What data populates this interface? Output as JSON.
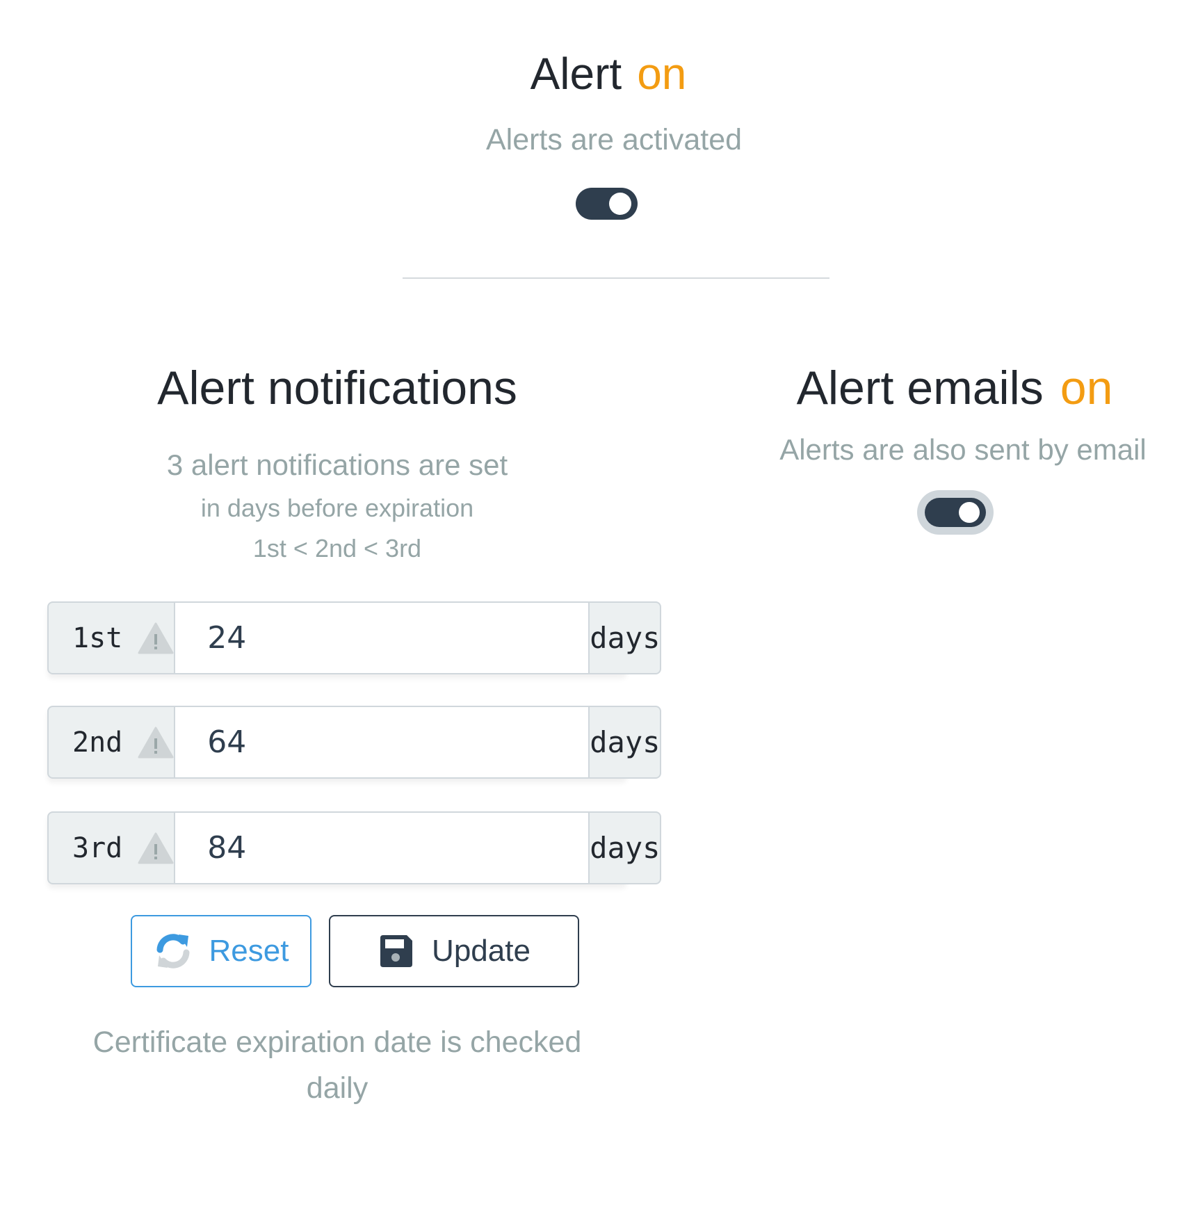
{
  "alert": {
    "title": "Alert",
    "state_label": "on",
    "subtitle": "Alerts are activated",
    "toggle_on": true
  },
  "notifications": {
    "title": "Alert notifications",
    "description_line1": "3 alert notifications are set",
    "description_line2": "in days before expiration",
    "description_line3": "1st < 2nd < 3rd",
    "rows": [
      {
        "ordinal": "1st",
        "value": "24",
        "unit": "days",
        "icon": "warning-icon"
      },
      {
        "ordinal": "2nd",
        "value": "64",
        "unit": "days",
        "icon": "warning-icon"
      },
      {
        "ordinal": "3rd",
        "value": "84",
        "unit": "days",
        "icon": "warning-icon"
      }
    ],
    "reset_label": "Reset",
    "reset_icon": "refresh-icon",
    "update_label": "Update",
    "update_icon": "floppy-disk-icon",
    "footer_note": "Certificate expiration date is checked daily"
  },
  "emails": {
    "title": "Alert emails",
    "state_label": "on",
    "subtitle": "Alerts are also sent by email",
    "toggle_on": true
  },
  "colors": {
    "accent_orange": "#f39c12",
    "muted_gray": "#95a5a6",
    "dark": "#2f3e4e",
    "reset_blue": "#3d9ae0"
  }
}
